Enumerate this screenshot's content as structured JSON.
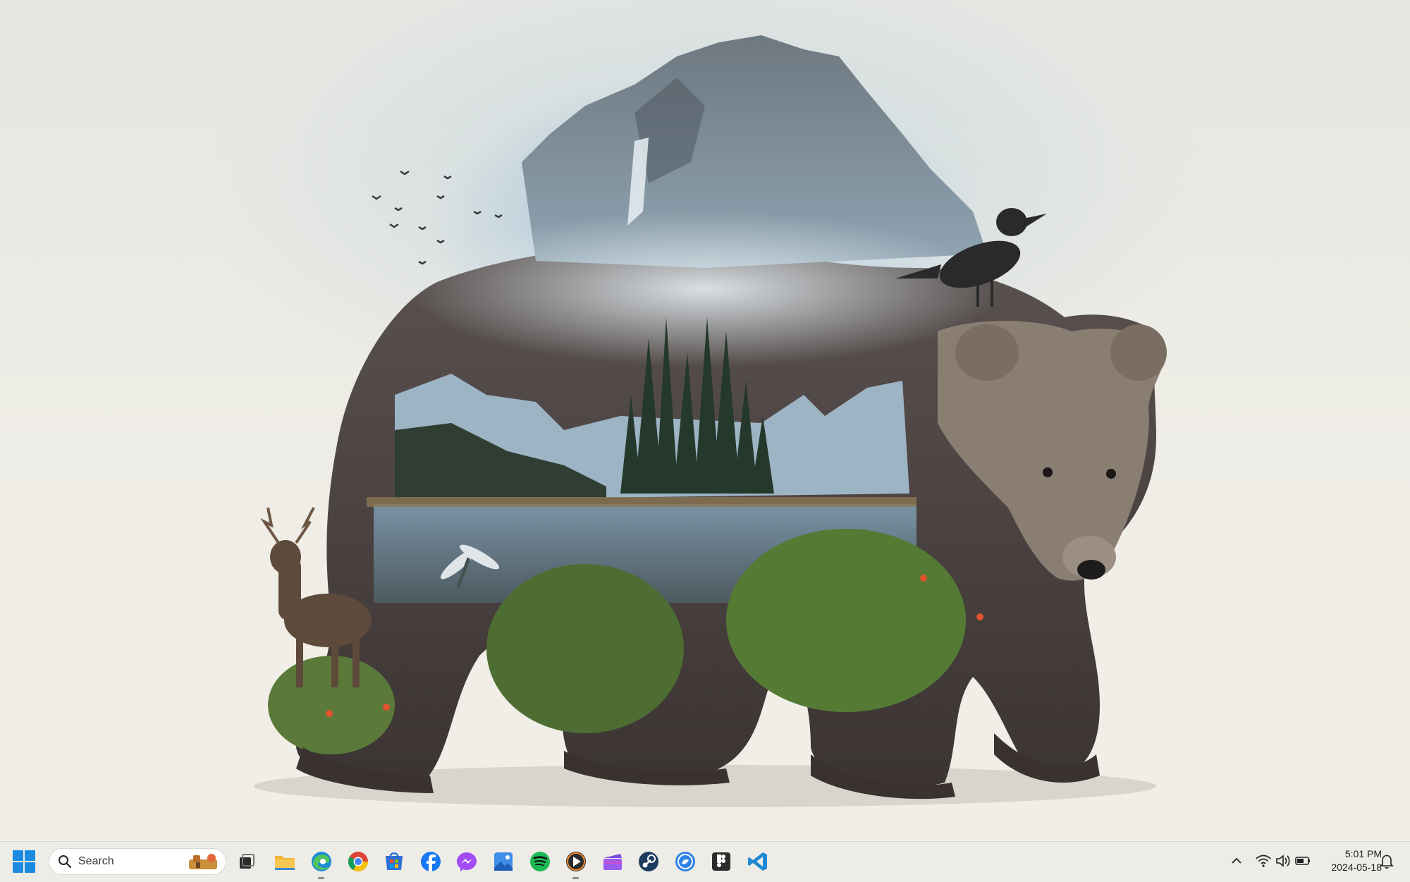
{
  "taskbar": {
    "search": {
      "label": "Search"
    },
    "apps": [
      {
        "name": "task-view",
        "running": false
      },
      {
        "name": "file-explorer",
        "running": false
      },
      {
        "name": "edge",
        "running": true
      },
      {
        "name": "chrome",
        "running": false
      },
      {
        "name": "microsoft-store",
        "running": false
      },
      {
        "name": "facebook",
        "running": false
      },
      {
        "name": "messenger",
        "running": false
      },
      {
        "name": "photos",
        "running": false
      },
      {
        "name": "spotify",
        "running": false
      },
      {
        "name": "media-player",
        "running": true
      },
      {
        "name": "clipchamp",
        "running": false
      },
      {
        "name": "steam",
        "running": false
      },
      {
        "name": "copilot",
        "running": false
      },
      {
        "name": "figma",
        "running": false
      },
      {
        "name": "vscode",
        "running": false
      }
    ],
    "clock": {
      "time": "5:01 PM",
      "date": "2024-05-18"
    }
  },
  "colors": {
    "taskbar_bg": "#eeece7",
    "start_blue": "#1a8be0",
    "wallpaper_sky": "#bcd3e2"
  },
  "icons": {
    "start": "windows-logo",
    "search": "magnifier",
    "tray": [
      "chevron-up",
      "wifi",
      "speaker",
      "battery",
      "bell"
    ]
  }
}
